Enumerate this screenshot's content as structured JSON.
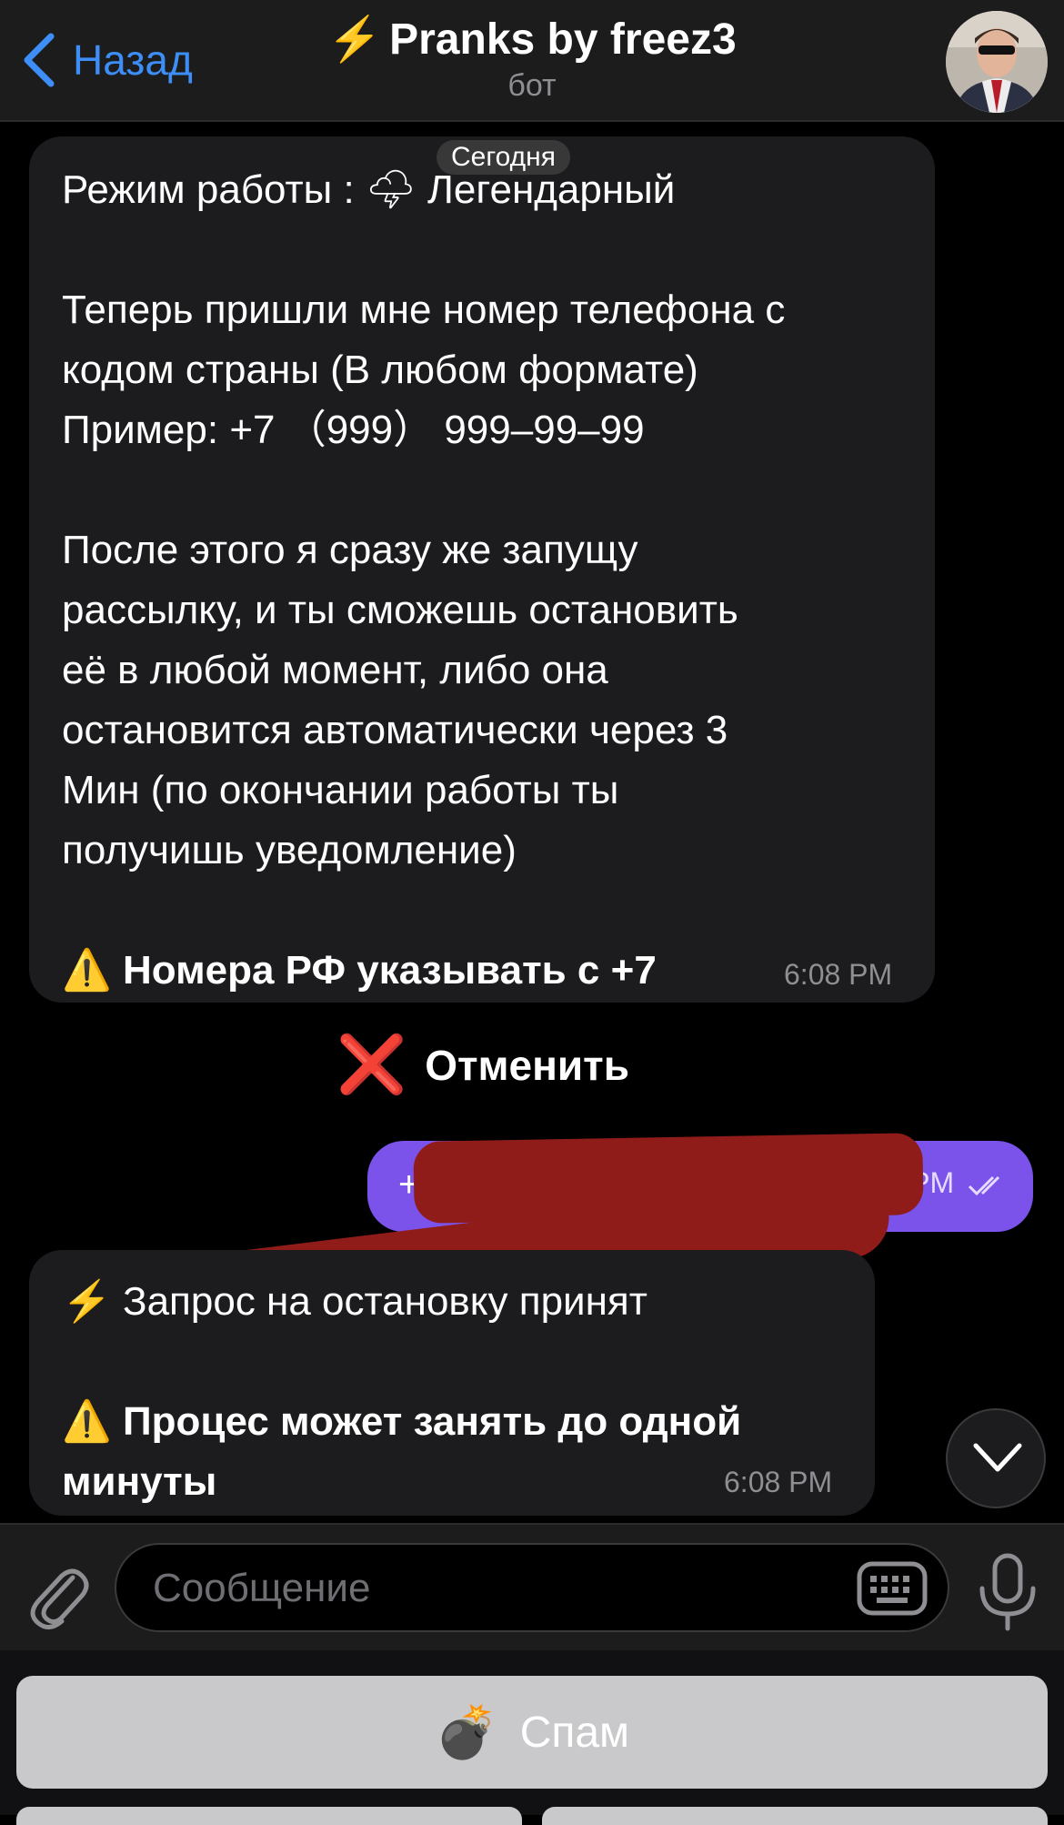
{
  "header": {
    "back_label": "Назад",
    "title_icon": "⚡️",
    "title": "Pranks by freez3",
    "subtitle": "бот"
  },
  "chat": {
    "date_label": "Сегодня",
    "message1": {
      "lines": [
        "Режим работы : 🌩 Легендарный",
        "",
        "Теперь пришли мне номер телефона с",
        "кодом страны (В любом формате)",
        "Пример: +7 （999） 999–99–99",
        "",
        "После этого я сразу же запущу",
        "рассылку, и ты сможешь остановить",
        "её в любой момент, либо она",
        "остановится автоматически через 3",
        "Мин (по окончании работы ты",
        "получишь уведомление)",
        ""
      ],
      "warning": "⚠️ Номера РФ указывать с +7",
      "time": "6:08 PM"
    },
    "cancel_button": {
      "icon": "❌",
      "label": "Отменить"
    },
    "outgoing": {
      "text": "+7",
      "time": "6:08 PM",
      "status": "read"
    },
    "message2": {
      "line1": "⚡️ Запрос на остановку принят",
      "warning_line1": "⚠️ Процес может занять до одной",
      "warning_line2": "минуты",
      "time": "6:08 PM"
    }
  },
  "input": {
    "placeholder": "Сообщение"
  },
  "keyboard": {
    "buttons": [
      {
        "icon": "💣",
        "label": "Спам"
      }
    ]
  },
  "colors": {
    "accent": "#3e8ef7",
    "outgoing_bubble": "#7b53ea",
    "incoming_bubble": "#1c1c1e",
    "background": "#000000"
  }
}
